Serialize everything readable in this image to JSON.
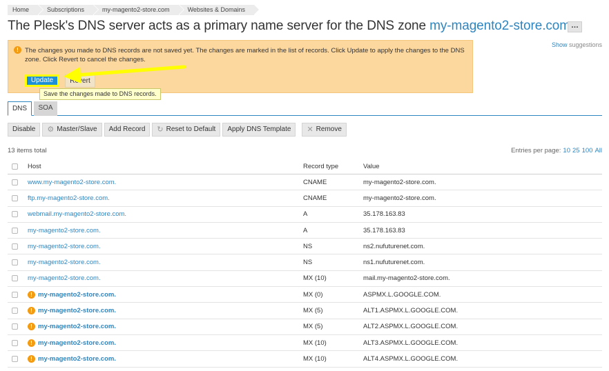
{
  "breadcrumb": [
    "Home",
    "Subscriptions",
    "my-magento2-store.com",
    "Websites & Domains"
  ],
  "title": {
    "prefix": "The Plesk's DNS server acts as a primary name server for the DNS zone ",
    "domain": "my-magento2-store.com",
    "more_label": "…"
  },
  "suggestions": {
    "link": "Show",
    "text": " suggestions"
  },
  "message": {
    "text": "The changes you made to DNS records are not saved yet. The changes are marked in the list of records. Click Update to apply the changes to the DNS zone. Click Revert to cancel the changes.",
    "update_label": "Update",
    "revert_label": "Revert",
    "tooltip": "Save the changes made to DNS records."
  },
  "tabs": [
    "DNS",
    "SOA"
  ],
  "toolbar": {
    "disable": "Disable",
    "master_slave": "Master/Slave",
    "add_record": "Add Record",
    "reset": "Reset to Default",
    "apply_template": "Apply DNS Template",
    "remove": "Remove"
  },
  "list": {
    "total": "13 items total",
    "per_page_label": "Entries per page:",
    "per_page_options": [
      "10",
      "25",
      "100",
      "All"
    ],
    "columns": {
      "host": "Host",
      "type": "Record type",
      "value": "Value"
    },
    "rows": [
      {
        "host": "www.my-magento2-store.com.",
        "type": "CNAME",
        "value": "my-magento2-store.com.",
        "changed": false
      },
      {
        "host": "ftp.my-magento2-store.com.",
        "type": "CNAME",
        "value": "my-magento2-store.com.",
        "changed": false
      },
      {
        "host": "webmail.my-magento2-store.com.",
        "type": "A",
        "value": "35.178.163.83",
        "changed": false
      },
      {
        "host": "my-magento2-store.com.",
        "type": "A",
        "value": "35.178.163.83",
        "changed": false
      },
      {
        "host": "my-magento2-store.com.",
        "type": "NS",
        "value": "ns2.nufuturenet.com.",
        "changed": false
      },
      {
        "host": "my-magento2-store.com.",
        "type": "NS",
        "value": "ns1.nufuturenet.com.",
        "changed": false
      },
      {
        "host": "my-magento2-store.com.",
        "type": "MX (10)",
        "value": "mail.my-magento2-store.com.",
        "changed": false
      },
      {
        "host": "my-magento2-store.com.",
        "type": "MX (0)",
        "value": "ASPMX.L.GOOGLE.COM.",
        "changed": true
      },
      {
        "host": "my-magento2-store.com.",
        "type": "MX (5)",
        "value": "ALT1.ASPMX.L.GOOGLE.COM.",
        "changed": true
      },
      {
        "host": "my-magento2-store.com.",
        "type": "MX (5)",
        "value": "ALT2.ASPMX.L.GOOGLE.COM.",
        "changed": true
      },
      {
        "host": "my-magento2-store.com.",
        "type": "MX (10)",
        "value": "ALT3.ASPMX.L.GOOGLE.COM.",
        "changed": true
      },
      {
        "host": "my-magento2-store.com.",
        "type": "MX (10)",
        "value": "ALT4.ASPMX.L.GOOGLE.COM.",
        "changed": true
      }
    ]
  },
  "colors": {
    "link": "#2e86c1",
    "warning_bg": "#fcd79e",
    "highlight": "#ffff00",
    "primary_button": "#1e90d8"
  },
  "icons": {
    "warning": "exclamation-circle-icon",
    "master_slave": "gear-icon",
    "reset": "refresh-icon",
    "remove": "close-icon"
  }
}
